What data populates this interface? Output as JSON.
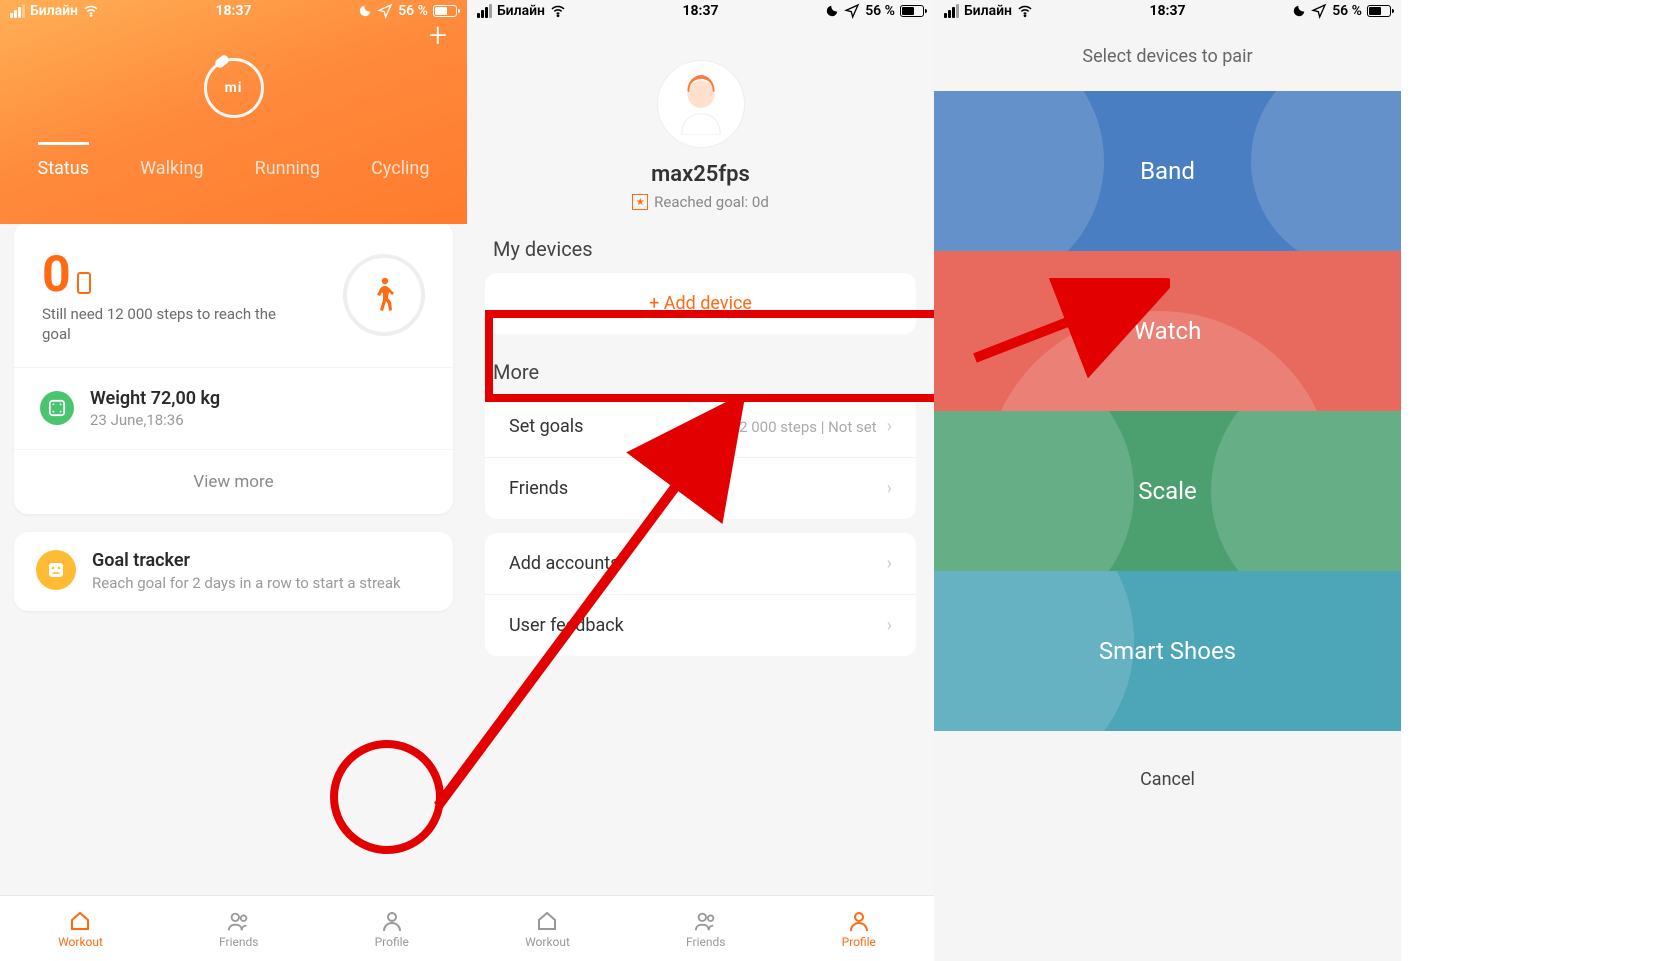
{
  "status": {
    "carrier": "Билайн",
    "time": "18:37",
    "battery": "56 %"
  },
  "screen1": {
    "tabs": [
      "Status",
      "Walking",
      "Running",
      "Cycling"
    ],
    "steps_count": "0",
    "steps_hint": "Still need 12 000 steps to reach the goal",
    "weight_title": "Weight 72,00 kg",
    "weight_date": "23 June,18:36",
    "view_more": "View more",
    "goal_tracker_title": "Goal tracker",
    "goal_tracker_sub": "Reach goal for 2 days in a row to start a streak",
    "tabbar": [
      "Workout",
      "Friends",
      "Profile"
    ]
  },
  "screen2": {
    "username": "max25fps",
    "reached_goal": "Reached goal: 0d",
    "section_devices": "My devices",
    "add_device": "Add device",
    "section_more": "More",
    "rows": {
      "set_goals": {
        "label": "Set goals",
        "value": "12 000 steps | Not set"
      },
      "friends": {
        "label": "Friends"
      },
      "add_accounts": {
        "label": "Add accounts"
      },
      "user_feedback": {
        "label": "User feedback"
      }
    },
    "tabbar": [
      "Workout",
      "Friends",
      "Profile"
    ]
  },
  "screen3": {
    "title": "Select devices to pair",
    "items": [
      "Band",
      "Watch",
      "Scale",
      "Smart Shoes"
    ],
    "cancel": "Cancel"
  }
}
